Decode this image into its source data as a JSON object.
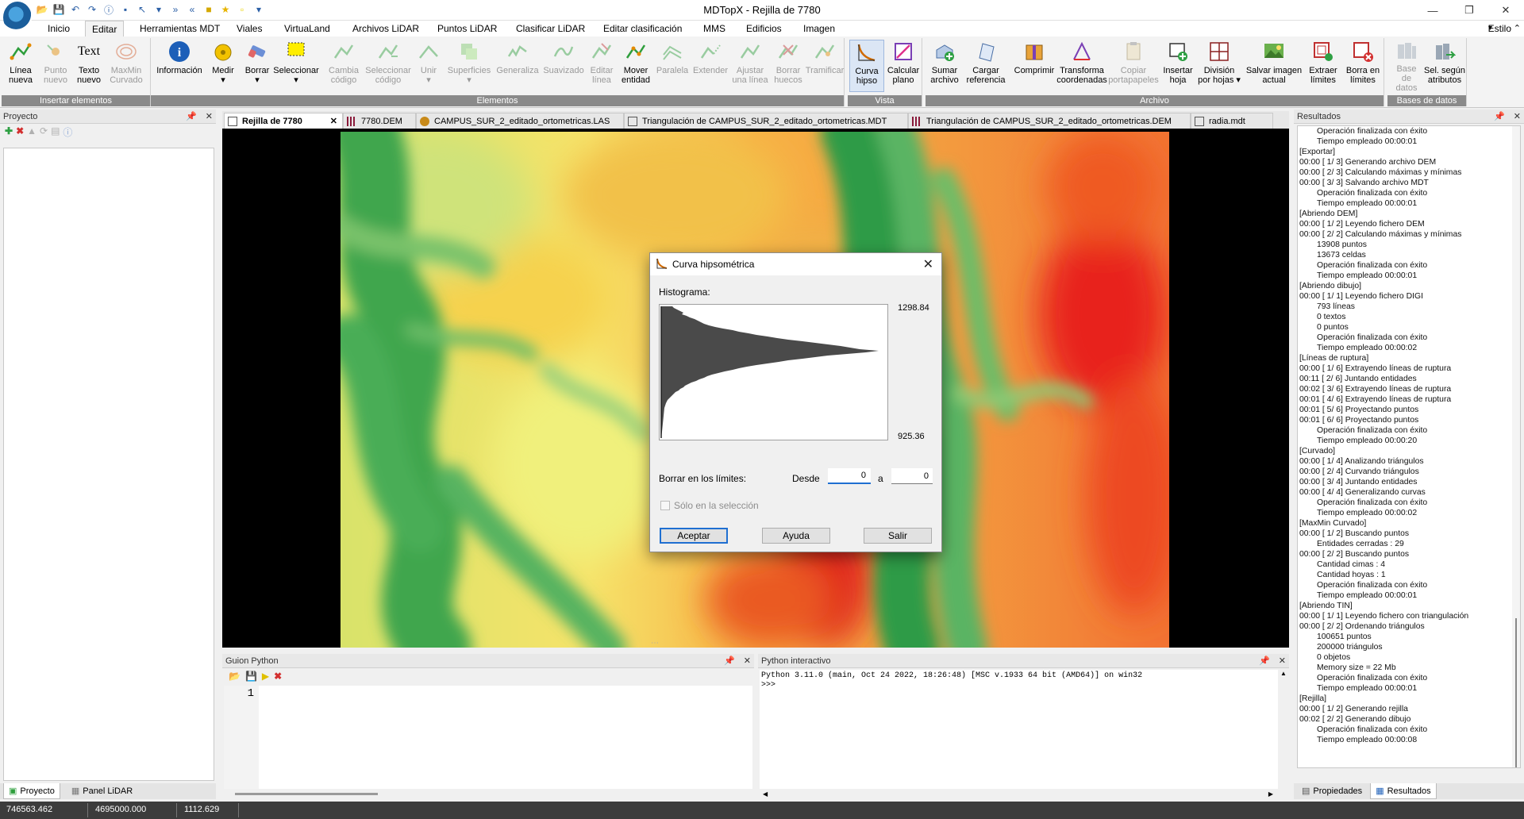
{
  "app": {
    "window_title": "MDTopX - Rejilla de 7780",
    "style_label": "Estilo"
  },
  "menu_tabs": [
    "Inicio",
    "Editar",
    "Herramientas MDT",
    "Viales",
    "VirtuaLand",
    "Archivos LiDAR",
    "Puntos LiDAR",
    "Clasificar LiDAR",
    "Editar clasificación",
    "MMS",
    "Edificios",
    "Imagen"
  ],
  "menu_active": "Editar",
  "ribbon": {
    "groups": {
      "insertar": "Insertar elementos",
      "elementos": "Elementos",
      "vista": "Vista",
      "archivo": "Archivo",
      "bases": "Bases de datos"
    },
    "buttons": {
      "linea_nueva": [
        "Línea",
        "nueva"
      ],
      "punto_nuevo": [
        "Punto",
        "nuevo"
      ],
      "texto_nuevo": [
        "Texto",
        "nuevo"
      ],
      "texto_icon_text": "Text",
      "maxmin": [
        "MaxMin",
        "Curvado"
      ],
      "informacion": [
        "Información",
        ""
      ],
      "medir": [
        "Medir",
        "▾"
      ],
      "borrar": [
        "Borrar",
        "▾"
      ],
      "seleccionar": [
        "Seleccionar",
        "▾"
      ],
      "cambia_codigo": [
        "Cambia",
        "código"
      ],
      "sel_codigo": [
        "Seleccionar",
        "código"
      ],
      "unir": [
        "Unir",
        "▾"
      ],
      "superficies": [
        "Superficies",
        "▾"
      ],
      "generaliza": [
        "Generaliza",
        ""
      ],
      "suavizado": [
        "Suavizado",
        ""
      ],
      "editar_linea": [
        "Editar",
        "línea"
      ],
      "mover_entidad": [
        "Mover",
        "entidad"
      ],
      "paralela": [
        "Paralela",
        ""
      ],
      "extender": [
        "Extender",
        ""
      ],
      "ajustar": [
        "Ajustar",
        "una línea"
      ],
      "borrar_huecos": [
        "Borrar",
        "huecos"
      ],
      "tramificar": [
        "Tramificar",
        ""
      ],
      "curva_hipso": [
        "Curva",
        "hipso"
      ],
      "calcular_plano": [
        "Calcular",
        "plano"
      ],
      "sumar_archivo": [
        "Sumar",
        "archivo"
      ],
      "cargar_ref": [
        "Cargar",
        "referencia"
      ],
      "comprimir": [
        "Comprimir",
        ""
      ],
      "transforma": [
        "Transforma",
        "coordenadas"
      ],
      "copiar_port": [
        "Copiar",
        "portapapeles"
      ],
      "insertar_hoja": [
        "Insertar",
        "hoja"
      ],
      "division_hojas": [
        "División",
        "por hojas ▾"
      ],
      "salvar_imagen": [
        "Salvar imagen",
        "actual"
      ],
      "extraer_limites": [
        "Extraer",
        "límites"
      ],
      "borra_limites": [
        "Borra en",
        "límites"
      ],
      "base_datos": [
        "Base de",
        "datos"
      ],
      "sel_atributos": [
        "Sel. según",
        "atributos"
      ]
    }
  },
  "left_panel": {
    "title": "Proyecto",
    "tabs": [
      "Proyecto",
      "Panel LiDAR"
    ]
  },
  "doc_tabs": [
    {
      "label": "Rejilla de 7780",
      "color": "#ffffff"
    },
    {
      "label": "7780.DEM",
      "color": "#f7c2d4"
    },
    {
      "label": "CAMPUS_SUR_2_editado_ortometricas.LAS",
      "color": "#f3df9c"
    },
    {
      "label": "Triangulación de CAMPUS_SUR_2_editado_ortometricas.MDT",
      "color": "#efe8c3"
    },
    {
      "label": "Triangulación de CAMPUS_SUR_2_editado_ortometricas.DEM",
      "color": "#f7c2d4"
    },
    {
      "label": "radia.mdt",
      "color": "#e6d7ef"
    }
  ],
  "dialog": {
    "title": "Curva hipsométrica",
    "hist_label": "Histograma:",
    "hist_max": "1298.84",
    "hist_min": "925.36",
    "borrar_label": "Borrar en los límites:",
    "desde_label": "Desde",
    "desde_value": "0",
    "a_label": "a",
    "hasta_value": "0",
    "sel_label": "Sólo en la selección",
    "btn_aceptar": "Aceptar",
    "btn_ayuda": "Ayuda",
    "btn_salir": "Salir"
  },
  "python_script": {
    "title": "Guion Python",
    "line_number": "1"
  },
  "python_interactive": {
    "title": "Python interactivo",
    "banner": "Python 3.11.0 (main, Oct 24 2022, 18:26:48) [MSC v.1933 64 bit (AMD64)] on win32",
    "prompt": ">>>"
  },
  "results": {
    "title": "Resultados",
    "tabs": [
      "Propiedades",
      "Resultados"
    ],
    "lines": [
      {
        "t": "Operación finalizada con éxito",
        "i": true
      },
      {
        "t": "Tiempo empleado 00:00:01",
        "i": true
      },
      {
        "t": "[Exportar]",
        "i": false
      },
      {
        "t": "00:00 [ 1/ 3] Generando archivo DEM",
        "i": false
      },
      {
        "t": "00:00 [ 2/ 3] Calculando máximas y mínimas",
        "i": false
      },
      {
        "t": "00:00 [ 3/ 3] Salvando archivo MDT",
        "i": false
      },
      {
        "t": "Operación finalizada con éxito",
        "i": true
      },
      {
        "t": "Tiempo empleado 00:00:01",
        "i": true
      },
      {
        "t": "[Abriendo DEM]",
        "i": false
      },
      {
        "t": "00:00 [ 1/ 2] Leyendo fichero DEM",
        "i": false
      },
      {
        "t": "00:00 [ 2/ 2] Calculando máximas y mínimas",
        "i": false
      },
      {
        "t": "13908 puntos",
        "i": true
      },
      {
        "t": "13673 celdas",
        "i": true
      },
      {
        "t": "Operación finalizada con éxito",
        "i": true
      },
      {
        "t": "Tiempo empleado 00:00:01",
        "i": true
      },
      {
        "t": "[Abriendo dibujo]",
        "i": false
      },
      {
        "t": "00:00 [ 1/ 1] Leyendo fichero DIGI",
        "i": false
      },
      {
        "t": "793 líneas",
        "i": true
      },
      {
        "t": "0 textos",
        "i": true
      },
      {
        "t": "0 puntos",
        "i": true
      },
      {
        "t": "Operación finalizada con éxito",
        "i": true
      },
      {
        "t": "Tiempo empleado 00:00:02",
        "i": true
      },
      {
        "t": "[Líneas de ruptura]",
        "i": false
      },
      {
        "t": "00:00 [ 1/ 6] Extrayendo líneas de ruptura",
        "i": false
      },
      {
        "t": "00:11 [ 2/ 6] Juntando entidades",
        "i": false
      },
      {
        "t": "00:02 [ 3/ 6] Extrayendo líneas de ruptura",
        "i": false
      },
      {
        "t": "00:01 [ 4/ 6] Extrayendo líneas de ruptura",
        "i": false
      },
      {
        "t": "00:01 [ 5/ 6] Proyectando puntos",
        "i": false
      },
      {
        "t": "00:01 [ 6/ 6] Proyectando puntos",
        "i": false
      },
      {
        "t": "Operación finalizada con éxito",
        "i": true
      },
      {
        "t": "Tiempo empleado 00:00:20",
        "i": true
      },
      {
        "t": "[Curvado]",
        "i": false
      },
      {
        "t": "00:00 [ 1/ 4] Analizando triángulos",
        "i": false
      },
      {
        "t": "00:00 [ 2/ 4] Curvando triángulos",
        "i": false
      },
      {
        "t": "00:00 [ 3/ 4] Juntando entidades",
        "i": false
      },
      {
        "t": "00:00 [ 4/ 4] Generalizando curvas",
        "i": false
      },
      {
        "t": "Operación finalizada con éxito",
        "i": true
      },
      {
        "t": "Tiempo empleado 00:00:02",
        "i": true
      },
      {
        "t": "[MaxMin Curvado]",
        "i": false
      },
      {
        "t": "00:00 [ 1/ 2] Buscando puntos",
        "i": false
      },
      {
        "t": "Entidades cerradas : 29",
        "i": true
      },
      {
        "t": "00:00 [ 2/ 2] Buscando puntos",
        "i": false
      },
      {
        "t": "Cantidad cimas : 4",
        "i": true
      },
      {
        "t": "Cantidad hoyas : 1",
        "i": true
      },
      {
        "t": "Operación finalizada con éxito",
        "i": true
      },
      {
        "t": "Tiempo empleado 00:00:01",
        "i": true
      },
      {
        "t": "[Abriendo TIN]",
        "i": false
      },
      {
        "t": "00:00 [ 1/ 1] Leyendo fichero con triangulación",
        "i": false
      },
      {
        "t": "00:00 [ 2/ 2] Ordenando triángulos",
        "i": false
      },
      {
        "t": "100651 puntos",
        "i": true
      },
      {
        "t": "200000 triángulos",
        "i": true
      },
      {
        "t": "0 objetos",
        "i": true
      },
      {
        "t": "Memory size = 22 Mb",
        "i": true
      },
      {
        "t": "Operación finalizada con éxito",
        "i": true
      },
      {
        "t": "Tiempo empleado 00:00:01",
        "i": true
      },
      {
        "t": "[Rejilla]",
        "i": false
      },
      {
        "t": "00:00 [ 1/ 2] Generando rejilla",
        "i": false
      },
      {
        "t": "00:02 [ 2/ 2] Generando dibujo",
        "i": false
      },
      {
        "t": "Operación finalizada con éxito",
        "i": true
      },
      {
        "t": "Tiempo empleado 00:00:08",
        "i": true
      }
    ]
  },
  "statusbar": {
    "x": "746563.462",
    "y": "4695000.000",
    "z": "1112.629"
  }
}
